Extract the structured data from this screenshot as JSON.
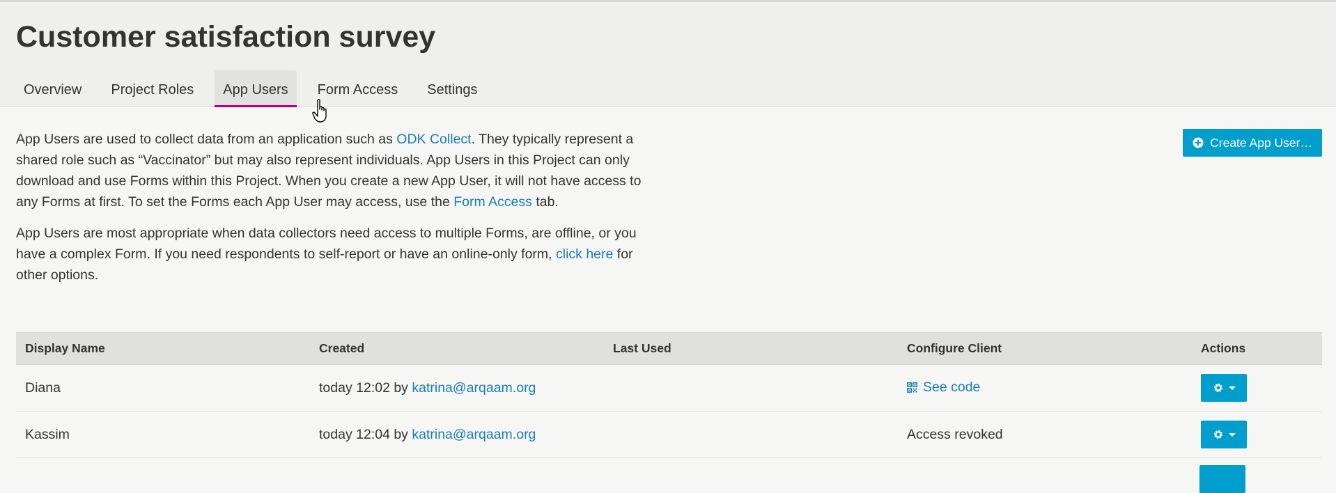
{
  "page": {
    "title": "Customer satisfaction survey"
  },
  "tabs": [
    {
      "label": "Overview"
    },
    {
      "label": "Project Roles"
    },
    {
      "label": "App Users"
    },
    {
      "label": "Form Access"
    },
    {
      "label": "Settings"
    }
  ],
  "active_tab": "App Users",
  "intro": {
    "p1_before": "App Users are used to collect data from an application such as ",
    "p1_link1": "ODK Collect",
    "p1_middle": ". They typically represent a shared role such as “Vaccinator” but may also represent individuals. App Users in this Project can only download and use Forms within this Project. When you create a new App User, it will not have access to any Forms at first. To set the Forms each App User may access, use the ",
    "p1_link2": "Form Access",
    "p1_after": " tab.",
    "p2_before": "App Users are most appropriate when data collectors need access to multiple Forms, are offline, or you have a complex Form. If you need respondents to self-report or have an online-only form, ",
    "p2_link": "click here",
    "p2_after": " for other options."
  },
  "create_button": {
    "label": "Create App User…"
  },
  "table": {
    "headers": {
      "display_name": "Display Name",
      "created": "Created",
      "last_used": "Last Used",
      "configure_client": "Configure Client",
      "actions": "Actions"
    },
    "rows": [
      {
        "display_name": "Diana",
        "created_prefix": "today 12:02 by ",
        "created_by": "katrina@arqaam.org",
        "last_used": "",
        "configure_client": "See code"
      },
      {
        "display_name": "Kassim",
        "created_prefix": "today 12:04 by ",
        "created_by": "katrina@arqaam.org",
        "last_used": "",
        "configure_client": "Access revoked"
      }
    ]
  },
  "colors": {
    "accent": "#009ecc",
    "active_tab_underline": "#bd006b",
    "link": "#1b7db6"
  },
  "icons": {
    "create_button": "plus-circle-icon",
    "see_code": "qr-code-icon",
    "actions": "gear-icon"
  }
}
